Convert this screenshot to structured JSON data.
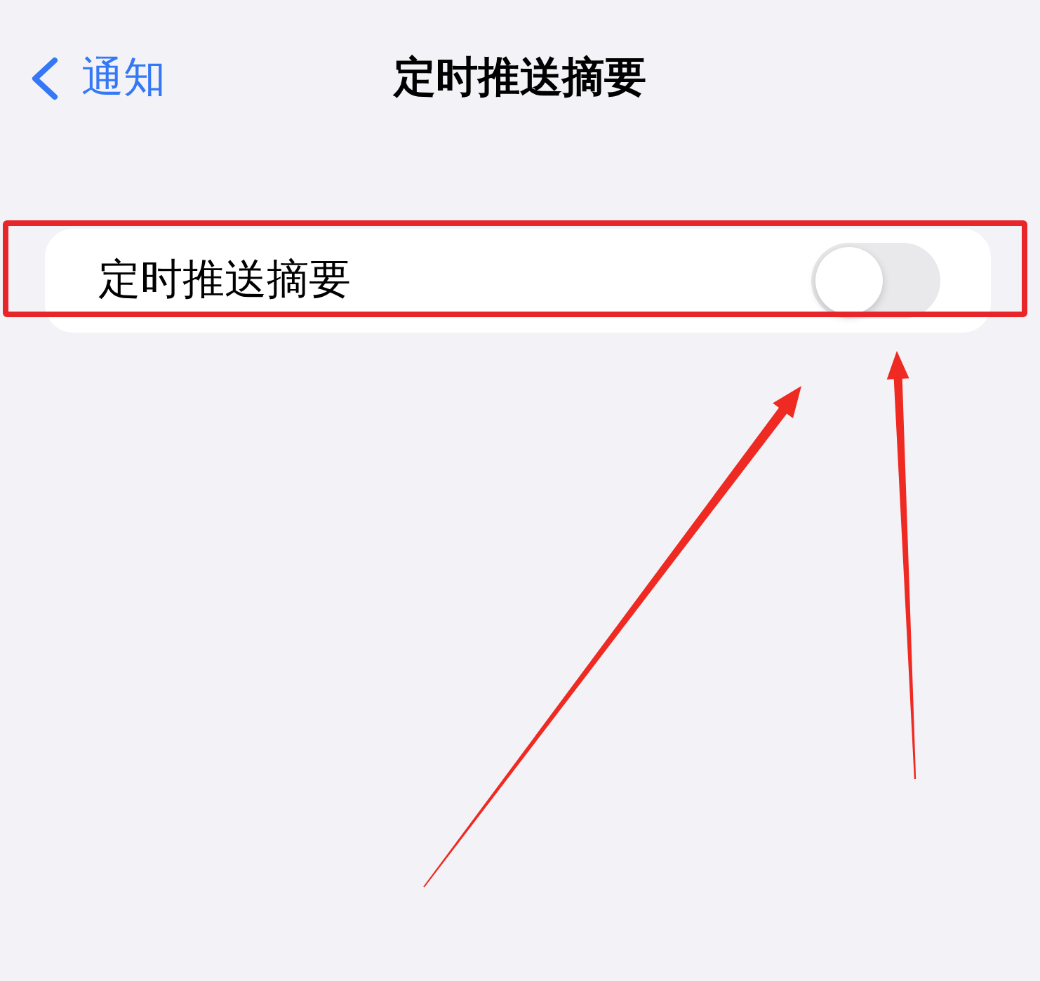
{
  "nav_bar": {
    "back_label": "通知",
    "title": "定时推送摘要"
  },
  "settings_group": {
    "rows": [
      {
        "kind": "toggle",
        "label": "定时推送摘要",
        "on": false
      }
    ]
  }
}
